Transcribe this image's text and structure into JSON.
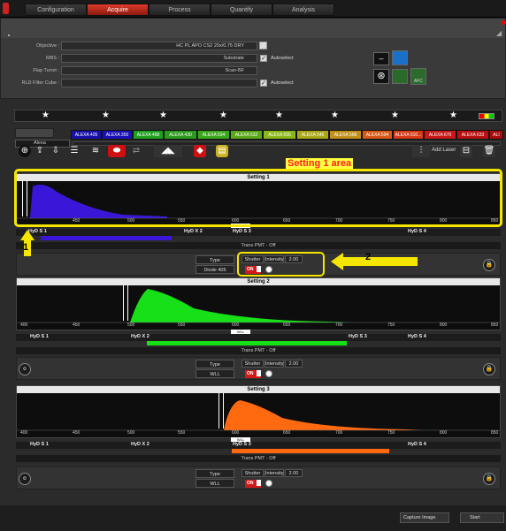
{
  "tabs": [
    "Configuration",
    "Acquire",
    "Process",
    "Quantify",
    "Analysis"
  ],
  "config": {
    "objective_label": "Objective :",
    "objective_value": "HC PL APO CS2  20x/0.75 DRY",
    "mbs_label": "MBS :",
    "mbs_value": "Substrate",
    "flap_label": "Flap Turret :",
    "flap_value": "Scan-BF",
    "rld_label": "RLD Filter Cube :",
    "autoselect": "Autoselect",
    "afc_label": "AFC"
  },
  "dye_list": {
    "selected": "Alexa",
    "dyes": [
      "ALEXA 405",
      "ALEXA 350",
      "ALEXA 488",
      "ALEXA 430",
      "ALEXA 594",
      "ALEXA 532",
      "ALEXA 555",
      "ALEXA 546",
      "ALEXA 568",
      "ALEXA 594",
      "ALEXA 610...",
      "ALEXA 670",
      "ALEXA 633",
      "ALI"
    ]
  },
  "toolbar": {
    "add_laser": "Add Laser"
  },
  "annotations": {
    "setting_area": "Setting 1 area",
    "marker_1": "1",
    "marker_2": "2"
  },
  "settings": [
    {
      "title": "Setting 1",
      "ticks": [
        "450",
        "500",
        "550",
        "600",
        "650",
        "700",
        "750",
        "800",
        "850"
      ],
      "wll": "WLL",
      "detectors": [
        "HyD S 1",
        "HyD X 2",
        "HyD S 3",
        "HyD S 4"
      ],
      "trans": "Trans PMT - Off",
      "type_label": "Type",
      "type_value": "Diode 405",
      "shutter": "Shutter",
      "intensity_label": "Intensity",
      "intensity_value": "2.00",
      "on": "ON",
      "color": "#3a17d8"
    },
    {
      "title": "Setting 2",
      "ticks": [
        "400",
        "450",
        "500",
        "550",
        "600",
        "650",
        "700",
        "750",
        "800",
        "850"
      ],
      "wll": "WLL",
      "detectors": [
        "HyD S 1",
        "HyD X 2",
        "HyD S 3",
        "HyD S 4"
      ],
      "trans": "Trans PMT - Off",
      "type_label": "Type",
      "type_value": "WLL",
      "shutter": "Shutter",
      "intensity_label": "Intensity",
      "intensity_value": "2.00",
      "on": "ON",
      "color": "#18e018"
    },
    {
      "title": "Setting 3",
      "ticks": [
        "400",
        "450",
        "500",
        "550",
        "600",
        "650",
        "700",
        "750",
        "800",
        "850"
      ],
      "wll": "WLL",
      "detectors": [
        "HyD S 1",
        "HyD X 2",
        "HyD S 3",
        "HyD S 4"
      ],
      "trans": "Trans PMT - Off",
      "type_label": "Type",
      "type_value": "WLL",
      "shutter": "Shutter",
      "intensity_label": "Intensity",
      "intensity_value": "2.00",
      "on": "ON",
      "color": "#ff6a10"
    }
  ],
  "bottom": {
    "capture": "Capture Image",
    "start": "Start"
  }
}
